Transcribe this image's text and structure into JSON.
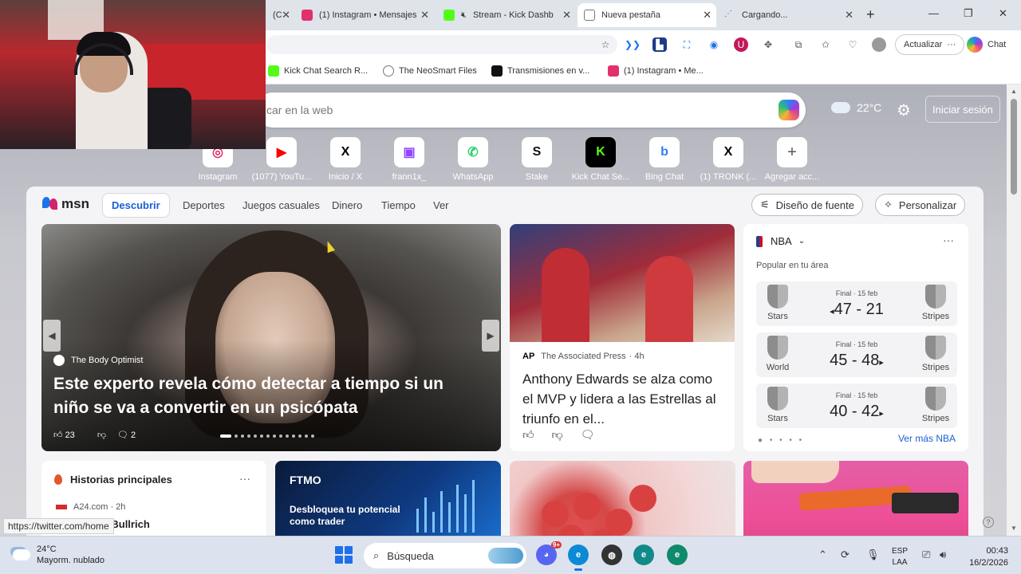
{
  "tabs": [
    {
      "label": "(C",
      "color": "#e4e4e4"
    },
    {
      "label": "(1) Instagram • Mensajes",
      "color": "#e1306c"
    },
    {
      "label": "Stream - Kick Dashb",
      "color": "#53fc18"
    },
    {
      "label": "Nueva pestaña",
      "color": "#ffffff"
    },
    {
      "label": "Cargando...",
      "color": "#bbbbbb"
    }
  ],
  "toolbar": {
    "update_label": "Actualizar",
    "chat_label": "Chat"
  },
  "bookmarks": [
    {
      "label": "Kick Chat Search R...",
      "color": "#53fc18"
    },
    {
      "label": "The NeoSmart Files",
      "color": "#777777"
    },
    {
      "label": "Transmisiones en v...",
      "color": "#111111"
    },
    {
      "label": "(1) Instagram • Me...",
      "color": "#e1306c"
    }
  ],
  "ntp": {
    "search_placeholder": "car en la web",
    "temperature": "22°C",
    "signin": "Iniciar sesión"
  },
  "quicklinks": [
    {
      "label": "Instagram",
      "glyph": "◎",
      "color": "#e1306c"
    },
    {
      "label": "(1077) YouTu...",
      "glyph": "▶",
      "color": "#ff0000"
    },
    {
      "label": "Inicio / X",
      "glyph": "X",
      "color": "#000000"
    },
    {
      "label": "frann1x_",
      "glyph": "▣",
      "color": "#9146ff"
    },
    {
      "label": "WhatsApp",
      "glyph": "✆",
      "color": "#25d366"
    },
    {
      "label": "Stake",
      "glyph": "S",
      "color": "#111111"
    },
    {
      "label": "Kick Chat Se...",
      "glyph": "K",
      "color": "#53fc18"
    },
    {
      "label": "Bing Chat",
      "glyph": "b",
      "color": "#2f7ff7"
    },
    {
      "label": "(1) TRONK (...",
      "glyph": "X",
      "color": "#000000"
    },
    {
      "label": "Agregar acc...",
      "glyph": "+",
      "color": "#555555"
    }
  ],
  "feed": {
    "logo": "msn",
    "tabs": [
      "Descubrir",
      "Deportes",
      "Juegos casuales",
      "Dinero",
      "Tiempo",
      "Ver"
    ],
    "font_design": "Diseño de fuente",
    "personalize": "Personalizar"
  },
  "hero": {
    "source": "The Body Optimist",
    "title": "Este experto revela cómo detectar a tiempo si un niño se va a convertir en un psicópata",
    "likes": "23",
    "comments": "2"
  },
  "card2": {
    "source": "AP",
    "publisher": "The Associated Press",
    "age": "· 4h",
    "title": "Anthony Edwards se alza como el MVP y lidera a las Estrellas al triunfo en el..."
  },
  "nba": {
    "league": "NBA",
    "popular": "Popular en tu área",
    "games": [
      {
        "home": "Stars",
        "away": "Stripes",
        "status": "Final · 15 feb",
        "score": "47 - 21",
        "winner_arrow": "◂"
      },
      {
        "home": "World",
        "away": "Stripes",
        "status": "Final · 15 feb",
        "score": "45 - 48",
        "winner_arrow": "▸"
      },
      {
        "home": "Stars",
        "away": "Stripes",
        "status": "Final · 15 feb",
        "score": "40 - 42",
        "winner_arrow": "▸"
      }
    ],
    "see_more": "Ver más NBA"
  },
  "stories": {
    "heading": "Historias principales",
    "source": "A24.com · 2h",
    "headline": "al: Patricia Bullrich"
  },
  "ad": {
    "brand": "FTMO",
    "text": "Desbloquea tu potencial como trader"
  },
  "status_url": "https://twitter.com/home",
  "taskbar": {
    "weather_temp": "24°C",
    "weather_desc": "Mayorm. nublado",
    "search": "Búsqueda",
    "discord_badge": "9+",
    "lang_top": "ESP",
    "lang_bottom": "LAA",
    "time": "00:43",
    "date": "16/2/2026"
  }
}
